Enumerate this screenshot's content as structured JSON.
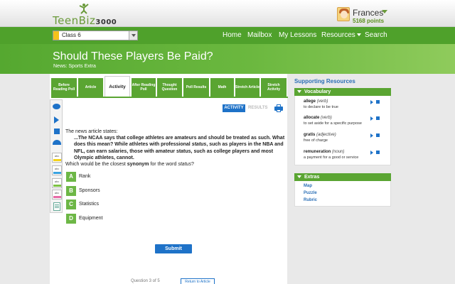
{
  "header": {
    "logo_text": "TeenBiz",
    "logo_suffix": "3000",
    "user_name": "Frances",
    "user_points": "5168 points"
  },
  "nav": {
    "class_select": "Class 6",
    "items": [
      "Home",
      "Mailbox",
      "My Lessons",
      "Resources",
      "Search"
    ]
  },
  "title": {
    "main": "Should These Players Be Paid?",
    "sub": "News: Sports Extra"
  },
  "tabs": [
    "Before Reading Poll",
    "Article",
    "Activity",
    "After Reading Poll",
    "Thought Question",
    "Poll Results",
    "Math",
    "Stretch Article",
    "Stretch Activity"
  ],
  "activity": {
    "activity_label": "ACTIVITY",
    "results_label": "RESULTS",
    "lead": "The news article states:",
    "quote_part1": "...The NCAA says that college athletes are amateurs and should be treated as such. What does this mean? While athletes with professional ",
    "quote_italic": "status",
    "quote_part2": ", such as players in the NBA and NFL, can earn salaries, those with amateur status, such as college players and most Olympic athletes, cannot.",
    "ask_part1": "Which would be the closest ",
    "ask_bold": "synonym",
    "ask_part2": " for the word ",
    "ask_italic": "status",
    "ask_part3": "?",
    "choices": [
      {
        "letter": "A",
        "text": "Rank"
      },
      {
        "letter": "B",
        "text": "Sponsors"
      },
      {
        "letter": "C",
        "text": "Statistics"
      },
      {
        "letter": "D",
        "text": "Equipment"
      }
    ],
    "submit_label": "Submit",
    "footer_text": "Question 3 of 5",
    "footer_button": "Return to Article"
  },
  "sidebar": {
    "title": "Supporting Resources",
    "vocab_heading": "Vocabulary",
    "vocab": [
      {
        "word": "allege",
        "pos": "(verb)",
        "def": "to declare to be true"
      },
      {
        "word": "allocate",
        "pos": "(verb)",
        "def": "to set aside for a specific purpose"
      },
      {
        "word": "gratis",
        "pos": "(adjective)",
        "def": "free of charge"
      },
      {
        "word": "remuneration",
        "pos": "(noun)",
        "def": "a payment for a good or service"
      }
    ],
    "extras_heading": "Extras",
    "extras": [
      "Map",
      "Puzzle",
      "Rubric"
    ]
  },
  "colors": {
    "brand_green": "#4fa12b",
    "accent_blue": "#1e72c8",
    "choice_green": "#6db746"
  }
}
